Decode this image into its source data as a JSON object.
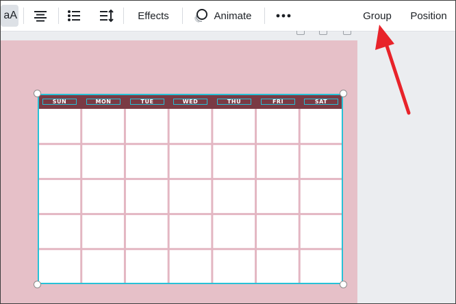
{
  "toolbar": {
    "text_case_label": "aA",
    "effects_label": "Effects",
    "animate_label": "Animate",
    "group_label": "Group",
    "position_label": "Position",
    "icons": [
      "align-center-icon",
      "list-bullets-icon",
      "line-spacing-icon",
      "animate-icon",
      "more-options-icon"
    ]
  },
  "calendar": {
    "days": [
      "SUN",
      "MON",
      "TUE",
      "WED",
      "THU",
      "FRI",
      "SAT"
    ],
    "week_rows": 5,
    "colors": {
      "page_background": "#e6c0c8",
      "header_band": "#7a3a44",
      "grid_lines": "#e3b6c2",
      "selection": "#27c1d6"
    }
  },
  "annotation": {
    "arrow_color": "#e8232a",
    "points_to": "group-button"
  }
}
